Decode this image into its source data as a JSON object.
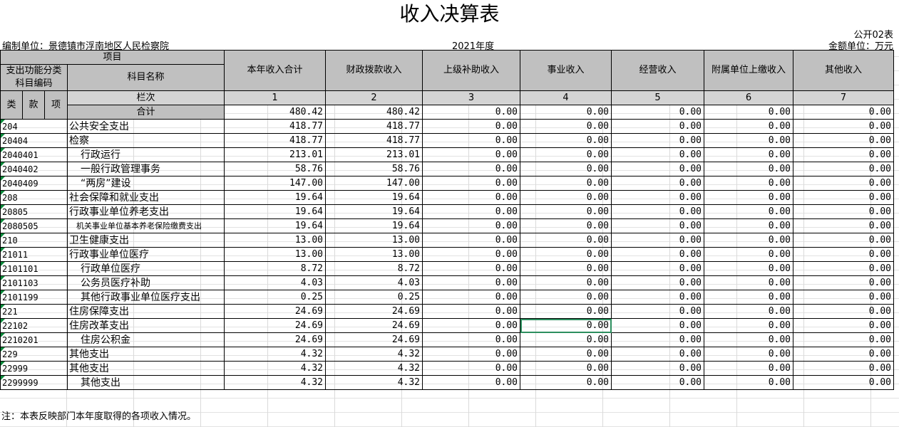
{
  "title": "收入决算表",
  "table_no": "公开02表",
  "unit": "编制单位：景德镇市浮南地区人民检察院",
  "year": "2021年度",
  "currency": "金额单位：万元",
  "headers": {
    "item": "项目",
    "func_code": "支出功能分类\n科目编码",
    "subject_name": "科目名称",
    "col_seq": "栏次",
    "total_label": "合计",
    "lei": "类",
    "kuan": "款",
    "xiang": "项",
    "cols": [
      "本年收入合计",
      "财政拨款收入",
      "上级补助收入",
      "事业收入",
      "经营收入",
      "附属单位上缴收入",
      "其他收入"
    ],
    "col_nums": [
      "1",
      "2",
      "3",
      "4",
      "5",
      "6",
      "7"
    ]
  },
  "total_row": [
    "480.42",
    "480.42",
    "0.00",
    "0.00",
    "0.00",
    "0.00",
    "0.00"
  ],
  "rows": [
    {
      "code": "204",
      "name": "公共安全支出",
      "vals": [
        "418.77",
        "418.77",
        "0.00",
        "0.00",
        "0.00",
        "0.00",
        "0.00"
      ]
    },
    {
      "code": "20404",
      "name": "检察",
      "vals": [
        "418.77",
        "418.77",
        "0.00",
        "0.00",
        "0.00",
        "0.00",
        "0.00"
      ]
    },
    {
      "code": "2040401",
      "name": "行政运行",
      "vals": [
        "213.01",
        "213.01",
        "0.00",
        "0.00",
        "0.00",
        "0.00",
        "0.00"
      ]
    },
    {
      "code": "2040402",
      "name": "一般行政管理事务",
      "vals": [
        "58.76",
        "58.76",
        "0.00",
        "0.00",
        "0.00",
        "0.00",
        "0.00"
      ]
    },
    {
      "code": "2040409",
      "name": "“两房”建设",
      "vals": [
        "147.00",
        "147.00",
        "0.00",
        "0.00",
        "0.00",
        "0.00",
        "0.00"
      ]
    },
    {
      "code": "208",
      "name": "社会保障和就业支出",
      "vals": [
        "19.64",
        "19.64",
        "0.00",
        "0.00",
        "0.00",
        "0.00",
        "0.00"
      ]
    },
    {
      "code": "20805",
      "name": "行政事业单位养老支出",
      "vals": [
        "19.64",
        "19.64",
        "0.00",
        "0.00",
        "0.00",
        "0.00",
        "0.00"
      ]
    },
    {
      "code": "2080505",
      "name": "机关事业单位基本养老保险缴费支出",
      "vals": [
        "19.64",
        "19.64",
        "0.00",
        "0.00",
        "0.00",
        "0.00",
        "0.00"
      ]
    },
    {
      "code": "210",
      "name": "卫生健康支出",
      "vals": [
        "13.00",
        "13.00",
        "0.00",
        "0.00",
        "0.00",
        "0.00",
        "0.00"
      ]
    },
    {
      "code": "21011",
      "name": "行政事业单位医疗",
      "vals": [
        "13.00",
        "13.00",
        "0.00",
        "0.00",
        "0.00",
        "0.00",
        "0.00"
      ]
    },
    {
      "code": "2101101",
      "name": "行政单位医疗",
      "vals": [
        "8.72",
        "8.72",
        "0.00",
        "0.00",
        "0.00",
        "0.00",
        "0.00"
      ]
    },
    {
      "code": "2101103",
      "name": "公务员医疗补助",
      "vals": [
        "4.03",
        "4.03",
        "0.00",
        "0.00",
        "0.00",
        "0.00",
        "0.00"
      ]
    },
    {
      "code": "2101199",
      "name": "其他行政事业单位医疗支出",
      "vals": [
        "0.25",
        "0.25",
        "0.00",
        "0.00",
        "0.00",
        "0.00",
        "0.00"
      ]
    },
    {
      "code": "221",
      "name": "住房保障支出",
      "vals": [
        "24.69",
        "24.69",
        "0.00",
        "0.00",
        "0.00",
        "0.00",
        "0.00"
      ]
    },
    {
      "code": "22102",
      "name": "住房改革支出",
      "vals": [
        "24.69",
        "24.69",
        "0.00",
        "0.00",
        "0.00",
        "0.00",
        "0.00"
      ]
    },
    {
      "code": "2210201",
      "name": "住房公积金",
      "vals": [
        "24.69",
        "24.69",
        "0.00",
        "0.00",
        "0.00",
        "0.00",
        "0.00"
      ]
    },
    {
      "code": "229",
      "name": "其他支出",
      "vals": [
        "4.32",
        "4.32",
        "0.00",
        "0.00",
        "0.00",
        "0.00",
        "0.00"
      ]
    },
    {
      "code": "22999",
      "name": "其他支出",
      "vals": [
        "4.32",
        "4.32",
        "0.00",
        "0.00",
        "0.00",
        "0.00",
        "0.00"
      ]
    },
    {
      "code": "2299999",
      "name": "其他支出",
      "vals": [
        "4.32",
        "4.32",
        "0.00",
        "0.00",
        "0.00",
        "0.00",
        "0.00"
      ]
    }
  ],
  "note": "注：本表反映部门本年度取得的各项收入情况。",
  "colors": {
    "header_bg": "#c0c0c0",
    "selection": "#2d8f5f",
    "corner_marker": "#0a8a3a"
  }
}
